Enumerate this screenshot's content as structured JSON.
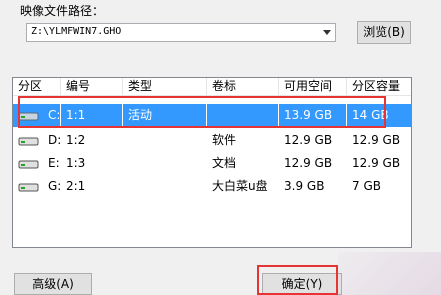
{
  "image_path": {
    "label": "映像文件路径：",
    "value": "Z:\\YLMFWIN7.GHO",
    "browse_label": "浏览(B)"
  },
  "table": {
    "columns": [
      "分区",
      "编号",
      "类型",
      "卷标",
      "可用空间",
      "分区容量"
    ],
    "rows": [
      {
        "partition": "C:",
        "number": "1:1",
        "type": "活动",
        "label": "",
        "free": "13.9 GB",
        "size": "14 GB",
        "selected": true
      },
      {
        "partition": "D:",
        "number": "1:2",
        "type": "",
        "label": "软件",
        "free": "12.9 GB",
        "size": "12.9 GB",
        "selected": false
      },
      {
        "partition": "E:",
        "number": "1:3",
        "type": "",
        "label": "文档",
        "free": "12.9 GB",
        "size": "12.9 GB",
        "selected": false
      },
      {
        "partition": "G:",
        "number": "2:1",
        "type": "",
        "label": "大白菜u盘",
        "free": "3.9 GB",
        "size": "7 GB",
        "selected": false
      }
    ]
  },
  "buttons": {
    "advanced_label": "高级(A)",
    "ok_label": "确定(Y)"
  },
  "colors": {
    "selection": "#3399ff",
    "highlight_box": "#e63434"
  }
}
